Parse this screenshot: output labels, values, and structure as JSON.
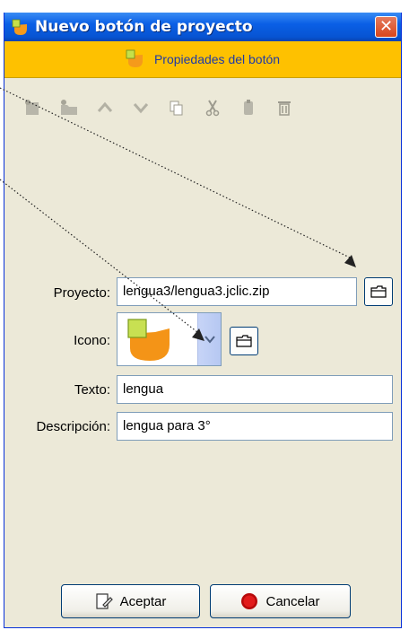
{
  "window": {
    "title": "Nuevo botón de proyecto",
    "close_label": "✕"
  },
  "header": {
    "text": "Propiedades del botón"
  },
  "toolbar": {
    "icons": [
      "add-page-icon",
      "add-folder-icon",
      "move-up-icon",
      "move-down-icon",
      "copy-icon",
      "cut-icon",
      "paste-icon",
      "delete-icon"
    ]
  },
  "form": {
    "proyecto_label": "Proyecto:",
    "proyecto_value": "lengua3/lengua3.jclic.zip",
    "icono_label": "Icono:",
    "texto_label": "Texto:",
    "texto_value": "lengua",
    "descripcion_label": "Descripción:",
    "descripcion_value": "lengua para 3°"
  },
  "buttons": {
    "accept": "Aceptar",
    "cancel": "Cancelar"
  },
  "colors": {
    "header_band": "#fec100",
    "header_text": "#1f3aa8",
    "titlebar": "#0754d2",
    "window_bg": "#ece9d8"
  }
}
